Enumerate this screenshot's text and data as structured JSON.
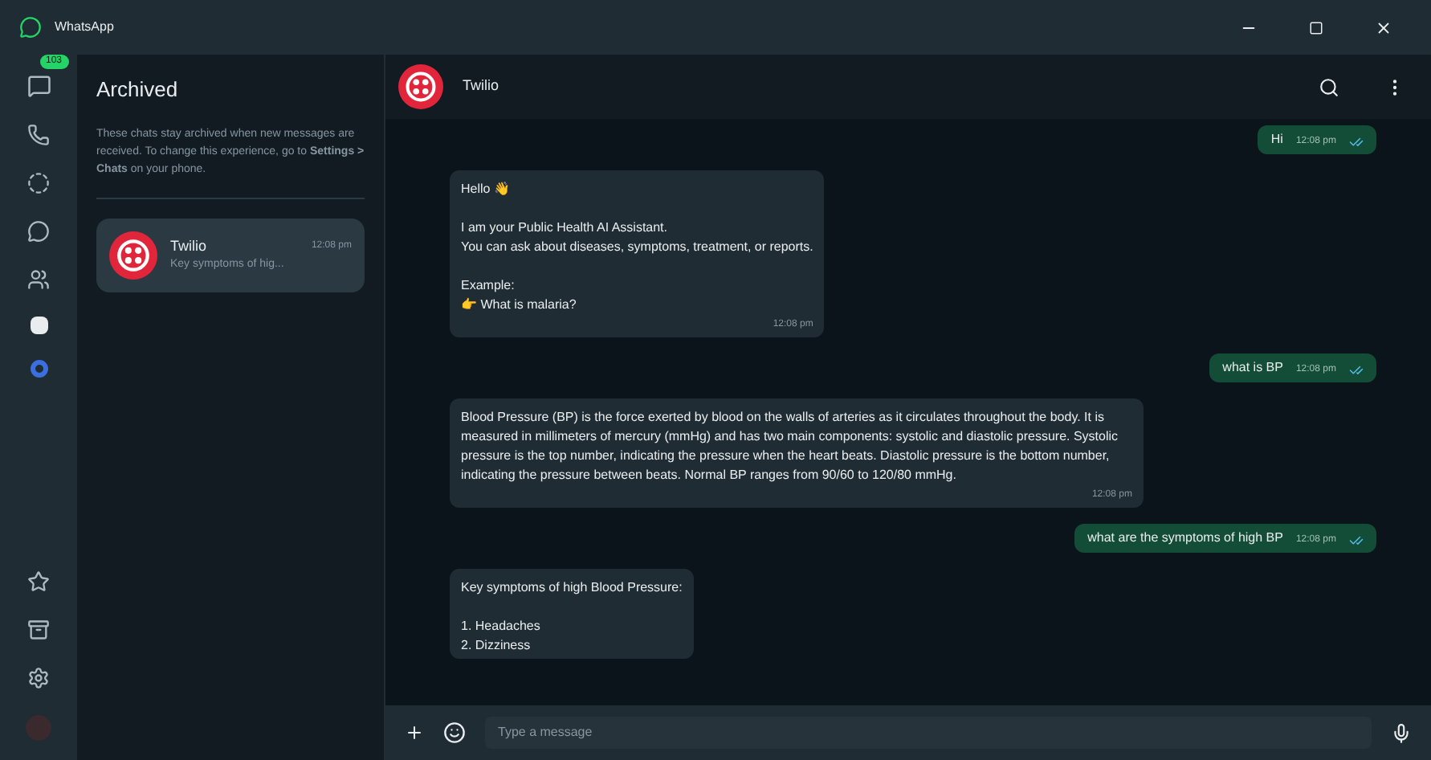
{
  "window": {
    "title": "WhatsApp"
  },
  "rail": {
    "badge": "103"
  },
  "archived": {
    "title": "Archived",
    "note": "These chats stay archived when new messages are received. To change this experience, go to **Settings > Chats** on your phone.",
    "chats": [
      {
        "name": "Twilio",
        "time": "12:08 pm",
        "preview": "Key symptoms of hig...",
        "selected": true
      }
    ]
  },
  "chat": {
    "name": "Twilio",
    "messages": [
      {
        "kind": "outgoing",
        "paragraphs": [
          [
            "Hi"
          ]
        ],
        "time": "12:08 pm"
      },
      {
        "kind": "incoming",
        "paragraphs": [
          [
            "Hello 👋"
          ],
          [
            "I am your Public Health AI Assistant.",
            "You can ask about diseases, symptoms, treatment, or reports."
          ],
          [
            "Example:",
            "👉 What is malaria?"
          ]
        ],
        "time": "12:08 pm"
      },
      {
        "kind": "outgoing",
        "paragraphs": [
          [
            "what is BP"
          ]
        ],
        "time": "12:08 pm"
      },
      {
        "kind": "incoming",
        "paragraphs": [
          [
            "Blood Pressure (BP) is the force exerted by blood on the walls of arteries as it circulates throughout the body. It is measured in millimeters of mercury (mmHg) and has two main components: systolic and diastolic pressure. Systolic pressure is the top number, indicating the pressure when the heart beats. Diastolic pressure is the bottom number, indicating the pressure between beats. Normal BP ranges from 90/60 to 120/80 mmHg."
          ]
        ],
        "time": "12:08 pm"
      },
      {
        "kind": "outgoing",
        "paragraphs": [
          [
            "what are the symptoms of high BP"
          ]
        ],
        "time": "12:08 pm"
      },
      {
        "kind": "incoming",
        "paragraphs": [
          [
            "Key symptoms of high Blood Pressure:"
          ],
          [
            "1. Headaches",
            "2. Dizziness"
          ]
        ]
      }
    ],
    "input": {
      "placeholder": "Type a message"
    }
  }
}
